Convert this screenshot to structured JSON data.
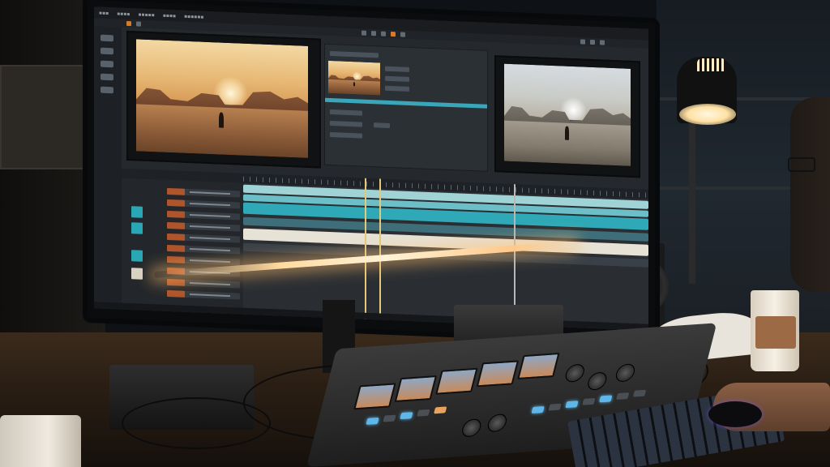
{
  "scene": {
    "description_label": "",
    "colors": {
      "accent_teal": "#3aa6b9",
      "timeline_cream": "#e6e2d6",
      "lamp_glow": "#ffe1a4",
      "lightbar": "#ffd9a0"
    }
  },
  "icons": [
    "desk-lamp-icon",
    "monitor-icon",
    "control-surface-icon",
    "coffee-cup-icon",
    "mouse-icon",
    "keyboard-icon",
    "speaker-icon"
  ]
}
